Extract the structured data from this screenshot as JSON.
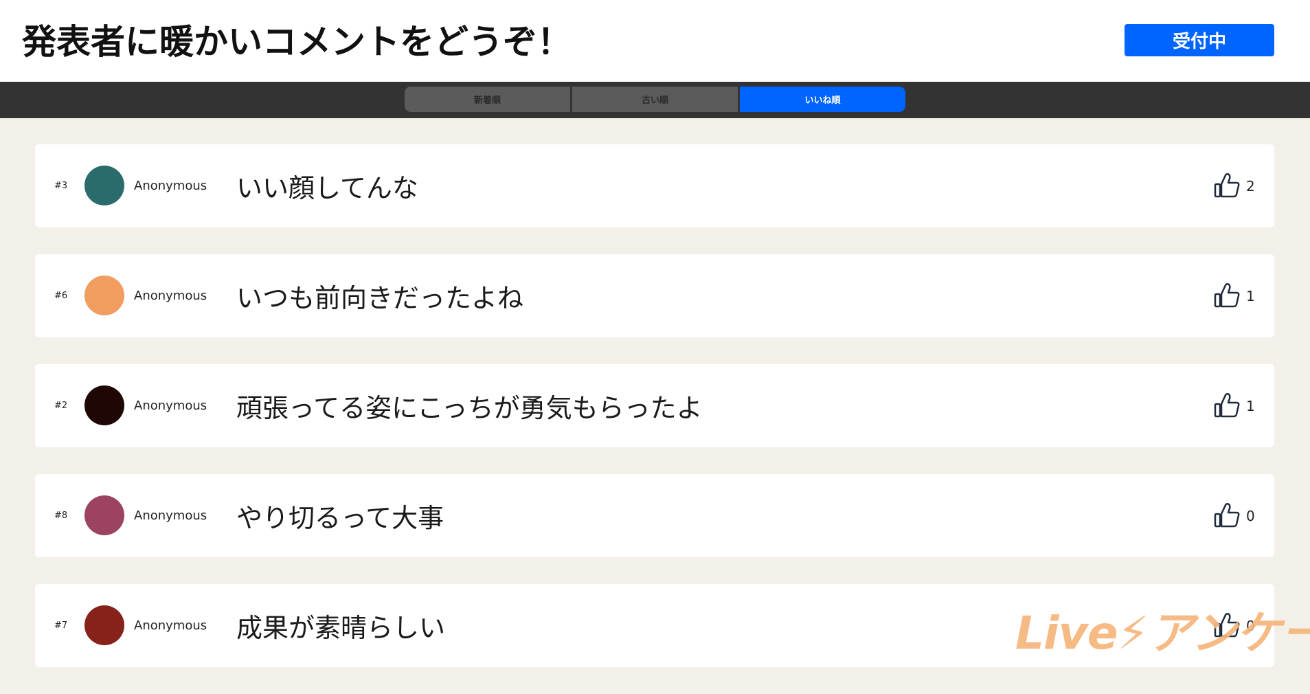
{
  "header": {
    "title": "発表者に暖かいコメントをどうぞ！",
    "status_button": "受付中",
    "accent_color": "#0064ff"
  },
  "tabs": [
    {
      "label": "新着順",
      "active": false
    },
    {
      "label": "古い順",
      "active": false
    },
    {
      "label": "いいね順",
      "active": true
    }
  ],
  "comments": [
    {
      "number": "#3",
      "author": "Anonymous",
      "avatar_color": "#2a6b6b",
      "text": "いい顔してんな",
      "likes": "2"
    },
    {
      "number": "#6",
      "author": "Anonymous",
      "avatar_color": "#f09d5f",
      "text": "いつも前向きだったよね",
      "likes": "1"
    },
    {
      "number": "#2",
      "author": "Anonymous",
      "avatar_color": "#1e0704",
      "text": "頑張ってる姿にこっちが勇気もらったよ",
      "likes": "1"
    },
    {
      "number": "#8",
      "author": "Anonymous",
      "avatar_color": "#9b4360",
      "text": "やり切るって大事",
      "likes": "0"
    },
    {
      "number": "#7",
      "author": "Anonymous",
      "avatar_color": "#87221a",
      "text": "成果が素晴らしい",
      "likes": "0"
    }
  ],
  "icons": {
    "like": "thumbs-up-icon"
  },
  "watermark": {
    "text": "Live⚡アンケート",
    "color": "#f6b57a"
  }
}
